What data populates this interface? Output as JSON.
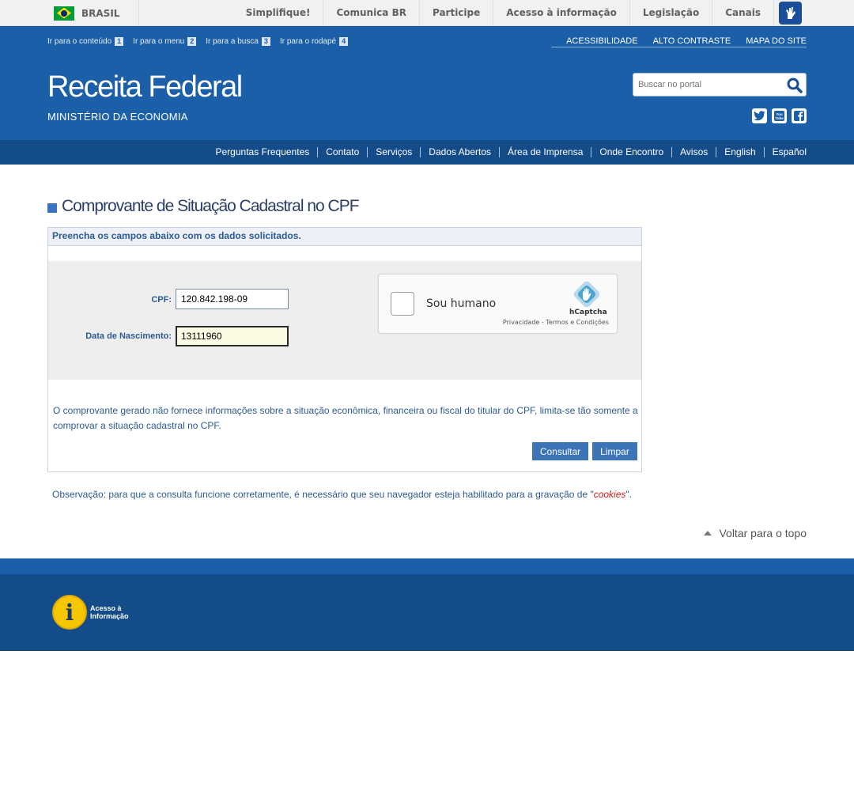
{
  "govbar": {
    "brasil_label": "BRASIL",
    "links": [
      "Simplifique!",
      "Comunica BR",
      "Participe",
      "Acesso à informação",
      "Legislação",
      "Canais"
    ]
  },
  "header": {
    "skip_links": [
      {
        "label": "Ir para o conteúdo",
        "num": "1"
      },
      {
        "label": "Ir para o menu",
        "num": "2"
      },
      {
        "label": "Ir para a busca",
        "num": "3"
      },
      {
        "label": "Ir para o rodapé",
        "num": "4"
      }
    ],
    "util_links": [
      "ACESSIBILIDADE",
      "ALTO CONTRASTE",
      "MAPA DO SITE"
    ],
    "title": "Receita Federal",
    "subtitle": "MINISTÉRIO DA ECONOMIA",
    "search_placeholder": "Buscar no portal",
    "social": [
      "twitter-icon",
      "youtube-icon",
      "facebook-icon"
    ]
  },
  "nav": [
    "Perguntas Frequentes",
    "Contato",
    "Serviços",
    "Dados Abertos",
    "Área de Imprensa",
    "Onde Encontro",
    "Avisos",
    "English",
    "Español"
  ],
  "main": {
    "heading": "Comprovante de Situação Cadastral no CPF",
    "form_header": "Preencha os campos abaixo com os dados solicitados.",
    "cpf_label": "CPF:",
    "cpf_value": "120.842.198-09",
    "birth_label": "Data de Nascimento:",
    "birth_value": "13111960",
    "captcha": {
      "label": "Sou humano",
      "brand": "hCaptcha",
      "links": "Privacidade - Termos e Condições"
    },
    "notice": "O comprovante gerado não fornece informações sobre a situação econômica, financeira ou fiscal do titular do CPF, limita-se tão somente a comprovar a situação cadastral no CPF.",
    "consult_button": "Consultar",
    "clear_button": "Limpar",
    "obs_prefix": "Observação: para que a consulta funcione corretamente, é necessário que seu navegador esteja habilitado para a gravação de \"",
    "obs_cookie": "cookies",
    "obs_suffix": "\".",
    "back_to_top": "Voltar para o topo"
  },
  "footer": {
    "ai_logo_line1": "Acesso à",
    "ai_logo_line2": "Informação"
  },
  "colors": {
    "header_blue": "#1b5fa8",
    "nav_blue": "#144c8a",
    "button_blue": "#3d74b8",
    "cookie_red": "#cc1b1b"
  }
}
